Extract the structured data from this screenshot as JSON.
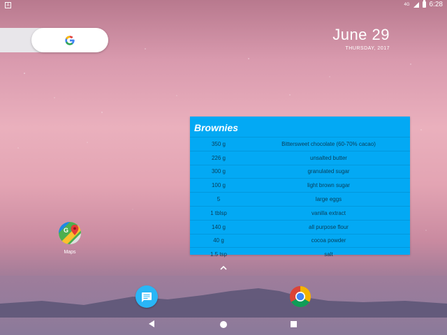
{
  "status_bar": {
    "left_icon": "notification-icon",
    "signal_label": "4G",
    "time": "6:28"
  },
  "search": {
    "icon": "google-logo-icon"
  },
  "clock_widget": {
    "date": "June 29",
    "weekday_year": "THURSDAY, 2017"
  },
  "recipe_widget": {
    "title": "Brownies",
    "rows": [
      {
        "qty": "350 g",
        "ingredient": "Bittersweet chocolate (60-70% cacao)"
      },
      {
        "qty": "226 g",
        "ingredient": "unsalted butter"
      },
      {
        "qty": "300 g",
        "ingredient": "granulated sugar"
      },
      {
        "qty": "100 g",
        "ingredient": "light brown sugar"
      },
      {
        "qty": "5",
        "ingredient": "large eggs"
      },
      {
        "qty": "1 tblsp",
        "ingredient": "vanilla extract"
      },
      {
        "qty": "140 g",
        "ingredient": "all purpose flour"
      },
      {
        "qty": "40 g",
        "ingredient": "cocoa powder"
      },
      {
        "qty": "1.5 tsp",
        "ingredient": "salt"
      }
    ]
  },
  "apps": {
    "maps": {
      "label": "Maps",
      "icon": "maps-icon"
    }
  },
  "dock": {
    "messages_icon": "messages-icon",
    "chrome_icon": "chrome-icon"
  },
  "colors": {
    "widget_bg": "#03a9f4",
    "messages_bg": "#29b6f6"
  }
}
